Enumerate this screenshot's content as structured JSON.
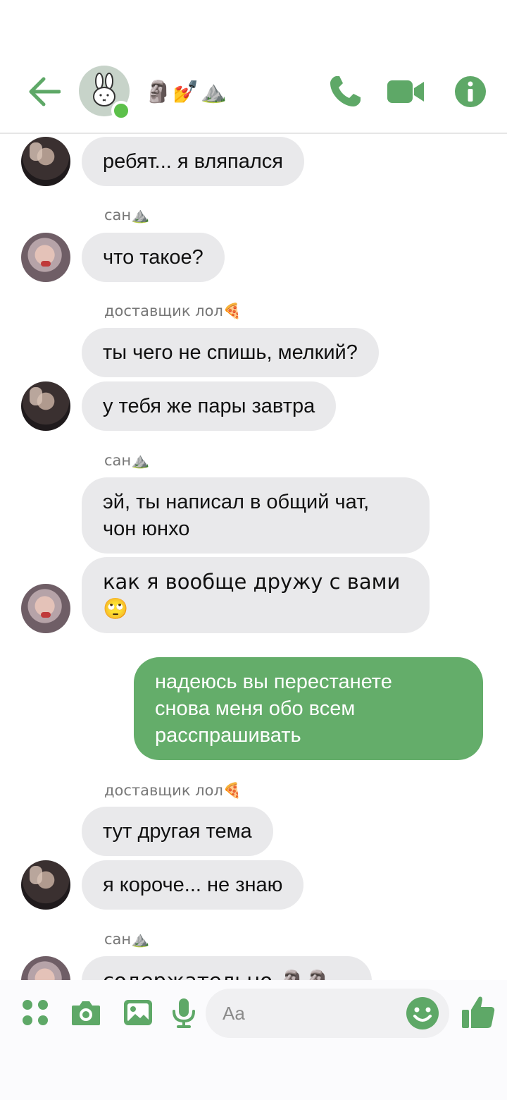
{
  "header": {
    "title": "🗿💅⛰️",
    "back_icon": "arrow-left-icon",
    "call_icon": "phone-icon",
    "video_icon": "video-camera-icon",
    "info_icon": "info-icon",
    "accent": "#5ea867"
  },
  "messages": [
    {
      "text": "ребят... я вляпался"
    },
    {
      "sender": "сан⛰️",
      "text": "что такое?"
    },
    {
      "sender": "доставщик лол🍕",
      "text": "ты чего не спишь, мелкий?"
    },
    {
      "text": "у тебя же пары завтра"
    },
    {
      "sender": "сан⛰️",
      "text": "эй, ты написал в общий чат,\nчон юнхо"
    },
    {
      "text": "как я вообще дружу с вами\n🙄"
    },
    {
      "text": "надеюсь вы перестанете\nснова меня обо всем\nрасспрашивать"
    },
    {
      "sender": "доставщик лол🍕",
      "text": "тут другая тема"
    },
    {
      "text": "я короче... не знаю"
    },
    {
      "sender": "сан⛰️",
      "text": "содержательно 🗿🗿🗿"
    }
  ],
  "composer": {
    "placeholder": "Aa",
    "icons": [
      "menu-icon",
      "camera-icon",
      "gallery-icon",
      "microphone-icon",
      "emoji-icon",
      "thumbs-up-icon"
    ]
  }
}
